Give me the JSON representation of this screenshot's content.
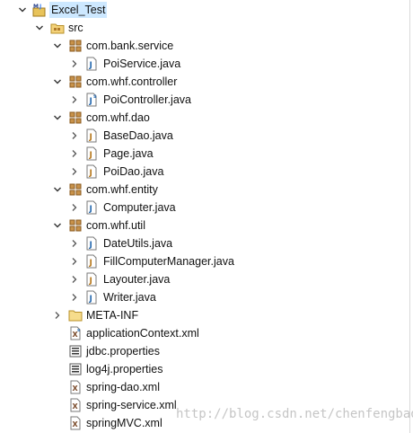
{
  "project": {
    "name": "Excel_Test"
  },
  "src_folder": {
    "name": "src"
  },
  "packages": [
    {
      "name": "com.bank.service",
      "files": [
        "PoiService.java"
      ]
    },
    {
      "name": "com.whf.controller",
      "files": [
        "PoiController.java"
      ]
    },
    {
      "name": "com.whf.dao",
      "files": [
        "BaseDao.java",
        "Page.java",
        "PoiDao.java"
      ]
    },
    {
      "name": "com.whf.entity",
      "files": [
        "Computer.java"
      ]
    },
    {
      "name": "com.whf.util",
      "files": [
        "DateUtils.java",
        "FillComputerManager.java",
        "Layouter.java",
        "Writer.java"
      ]
    }
  ],
  "meta_inf": {
    "name": "META-INF"
  },
  "root_files": [
    "applicationContext.xml",
    "jdbc.properties",
    "log4j.properties",
    "spring-dao.xml",
    "spring-service.xml",
    "springMVC.xml"
  ],
  "watermark": "http://blog.csdn.net/chenfengbao"
}
